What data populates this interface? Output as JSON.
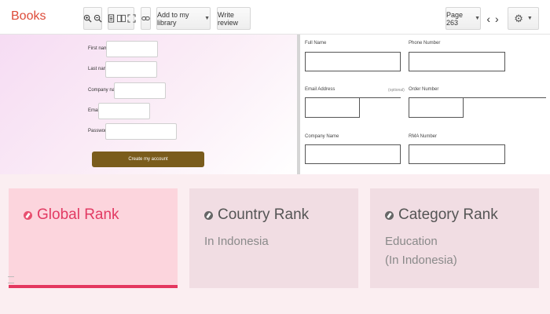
{
  "toolbar": {
    "title": "Books",
    "add_to_library": "Add to my library",
    "write_review": "Write review",
    "page_label": "Page 263"
  },
  "signup_form": {
    "first_name_label": "First name",
    "last_name_label": "Last name",
    "company_label": "Company name",
    "email_label": "Email",
    "password_label": "Password",
    "submit_label": "Create my account"
  },
  "order_form": {
    "full_name_label": "Full Name",
    "phone_label": "Phone Number",
    "email_label": "Email Address",
    "optional_label": "(optional)",
    "order_number_label": "Order Number",
    "company_label": "Company Name",
    "rma_label": "RMA Number"
  },
  "ranks": [
    {
      "title": "Global Rank",
      "subtitle": "",
      "active": true
    },
    {
      "title": "Country Rank",
      "subtitle": "In Indonesia",
      "active": false
    },
    {
      "title": "Category Rank",
      "subtitle": "Education\n(In Indonesia)",
      "active": false
    }
  ],
  "colors": {
    "title_red": "#dd4b39",
    "submit_brown": "#7a5c1c",
    "rank_accent": "#e23a63"
  }
}
